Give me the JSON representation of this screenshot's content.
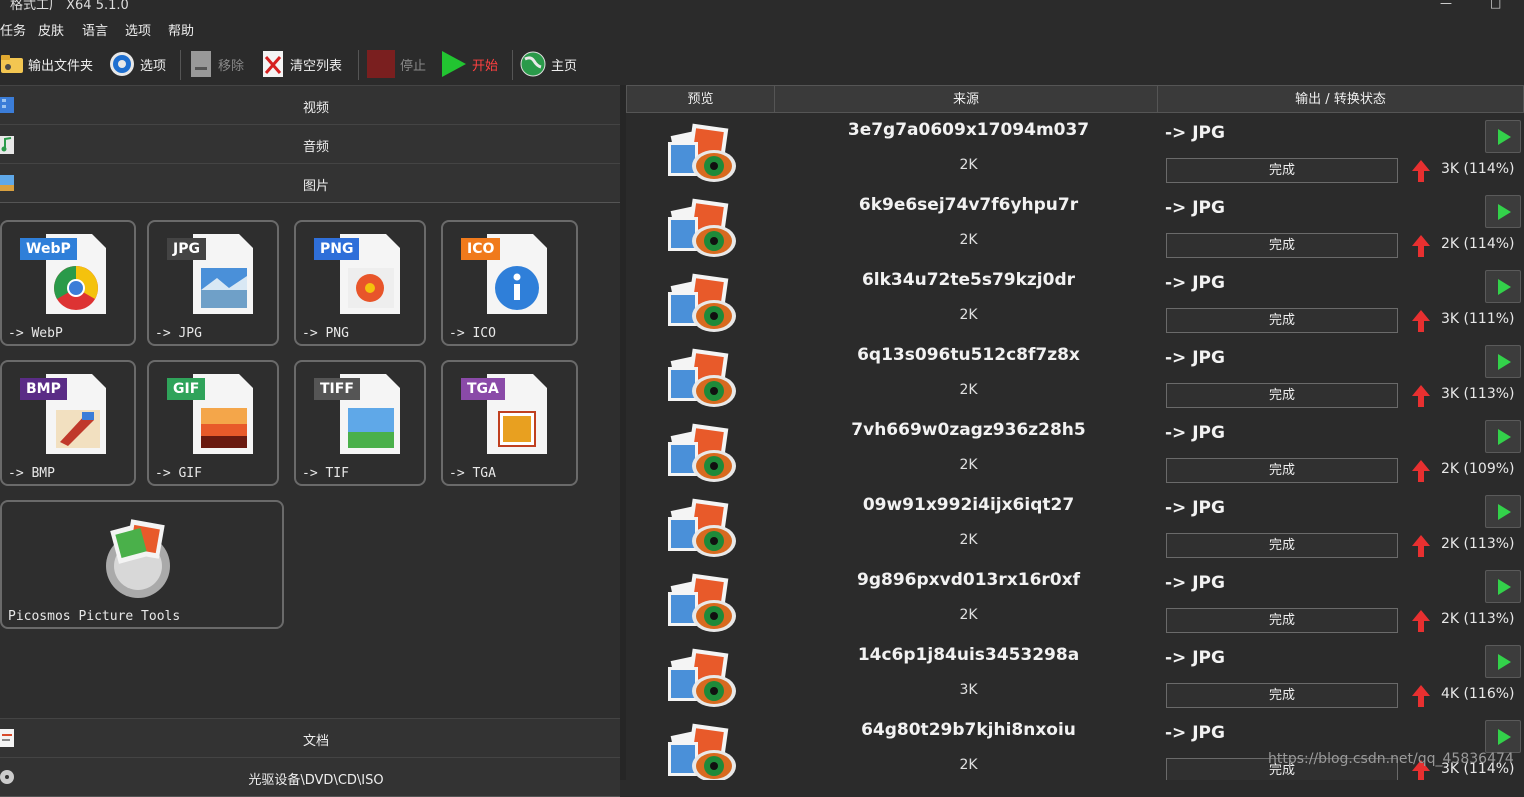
{
  "window": {
    "title": "格式工厂 X64 5.1.0"
  },
  "menu": [
    "任务",
    "皮肤",
    "语言",
    "选项",
    "帮助"
  ],
  "toolbar": {
    "output_folder": "输出文件夹",
    "options": "选项",
    "remove": "移除",
    "clear_list": "清空列表",
    "stop": "停止",
    "start": "开始",
    "home": "主页"
  },
  "categories": {
    "video": "视频",
    "audio": "音频",
    "picture": "图片",
    "document": "文档",
    "optical": "光驱设备\\DVD\\CD\\ISO"
  },
  "tiles": [
    {
      "badge": "WebP",
      "caption": "-> WebP",
      "color": "#2f7fd9"
    },
    {
      "badge": "JPG",
      "caption": "-> JPG",
      "color": "#444444"
    },
    {
      "badge": "PNG",
      "caption": "-> PNG",
      "color": "#2f6fd9"
    },
    {
      "badge": "ICO",
      "caption": "-> ICO",
      "color": "#f07a1c"
    },
    {
      "badge": "BMP",
      "caption": "-> BMP",
      "color": "#5a2c86"
    },
    {
      "badge": "GIF",
      "caption": "-> GIF",
      "color": "#2fa35a"
    },
    {
      "badge": "TIFF",
      "caption": "-> TIF",
      "color": "#555555"
    },
    {
      "badge": "TGA",
      "caption": "-> TGA",
      "color": "#8a4aa8"
    }
  ],
  "tool": {
    "caption": "Picosmos Picture Tools"
  },
  "columns": {
    "preview": "预览",
    "source": "来源",
    "output": "输出 / 转换状态"
  },
  "rows": [
    {
      "name": "3e7g7a0609x17094m037",
      "size": "2K",
      "format": "-> JPG",
      "status": "完成",
      "result": "3K  (114%)"
    },
    {
      "name": "6k9e6sej74v7f6yhpu7r",
      "size": "2K",
      "format": "-> JPG",
      "status": "完成",
      "result": "2K  (114%)"
    },
    {
      "name": "6lk34u72te5s79kzj0dr",
      "size": "2K",
      "format": "-> JPG",
      "status": "完成",
      "result": "3K  (111%)"
    },
    {
      "name": "6q13s096tu512c8f7z8x",
      "size": "2K",
      "format": "-> JPG",
      "status": "完成",
      "result": "3K  (113%)"
    },
    {
      "name": "7vh669w0zagz936z28h5",
      "size": "2K",
      "format": "-> JPG",
      "status": "完成",
      "result": "2K  (109%)"
    },
    {
      "name": "09w91x992i4ijx6iqt27",
      "size": "2K",
      "format": "-> JPG",
      "status": "完成",
      "result": "2K  (113%)"
    },
    {
      "name": "9g896pxvd013rx16r0xf",
      "size": "2K",
      "format": "-> JPG",
      "status": "完成",
      "result": "2K  (113%)"
    },
    {
      "name": "14c6p1j84uis3453298a",
      "size": "3K",
      "format": "-> JPG",
      "status": "完成",
      "result": "4K  (116%)"
    },
    {
      "name": "64g80t29b7kjhi8nxoiu",
      "size": "2K",
      "format": "-> JPG",
      "status": "完成",
      "result": "3K  (114%)"
    }
  ],
  "watermark": "https://blog.csdn.net/qq_45836474"
}
